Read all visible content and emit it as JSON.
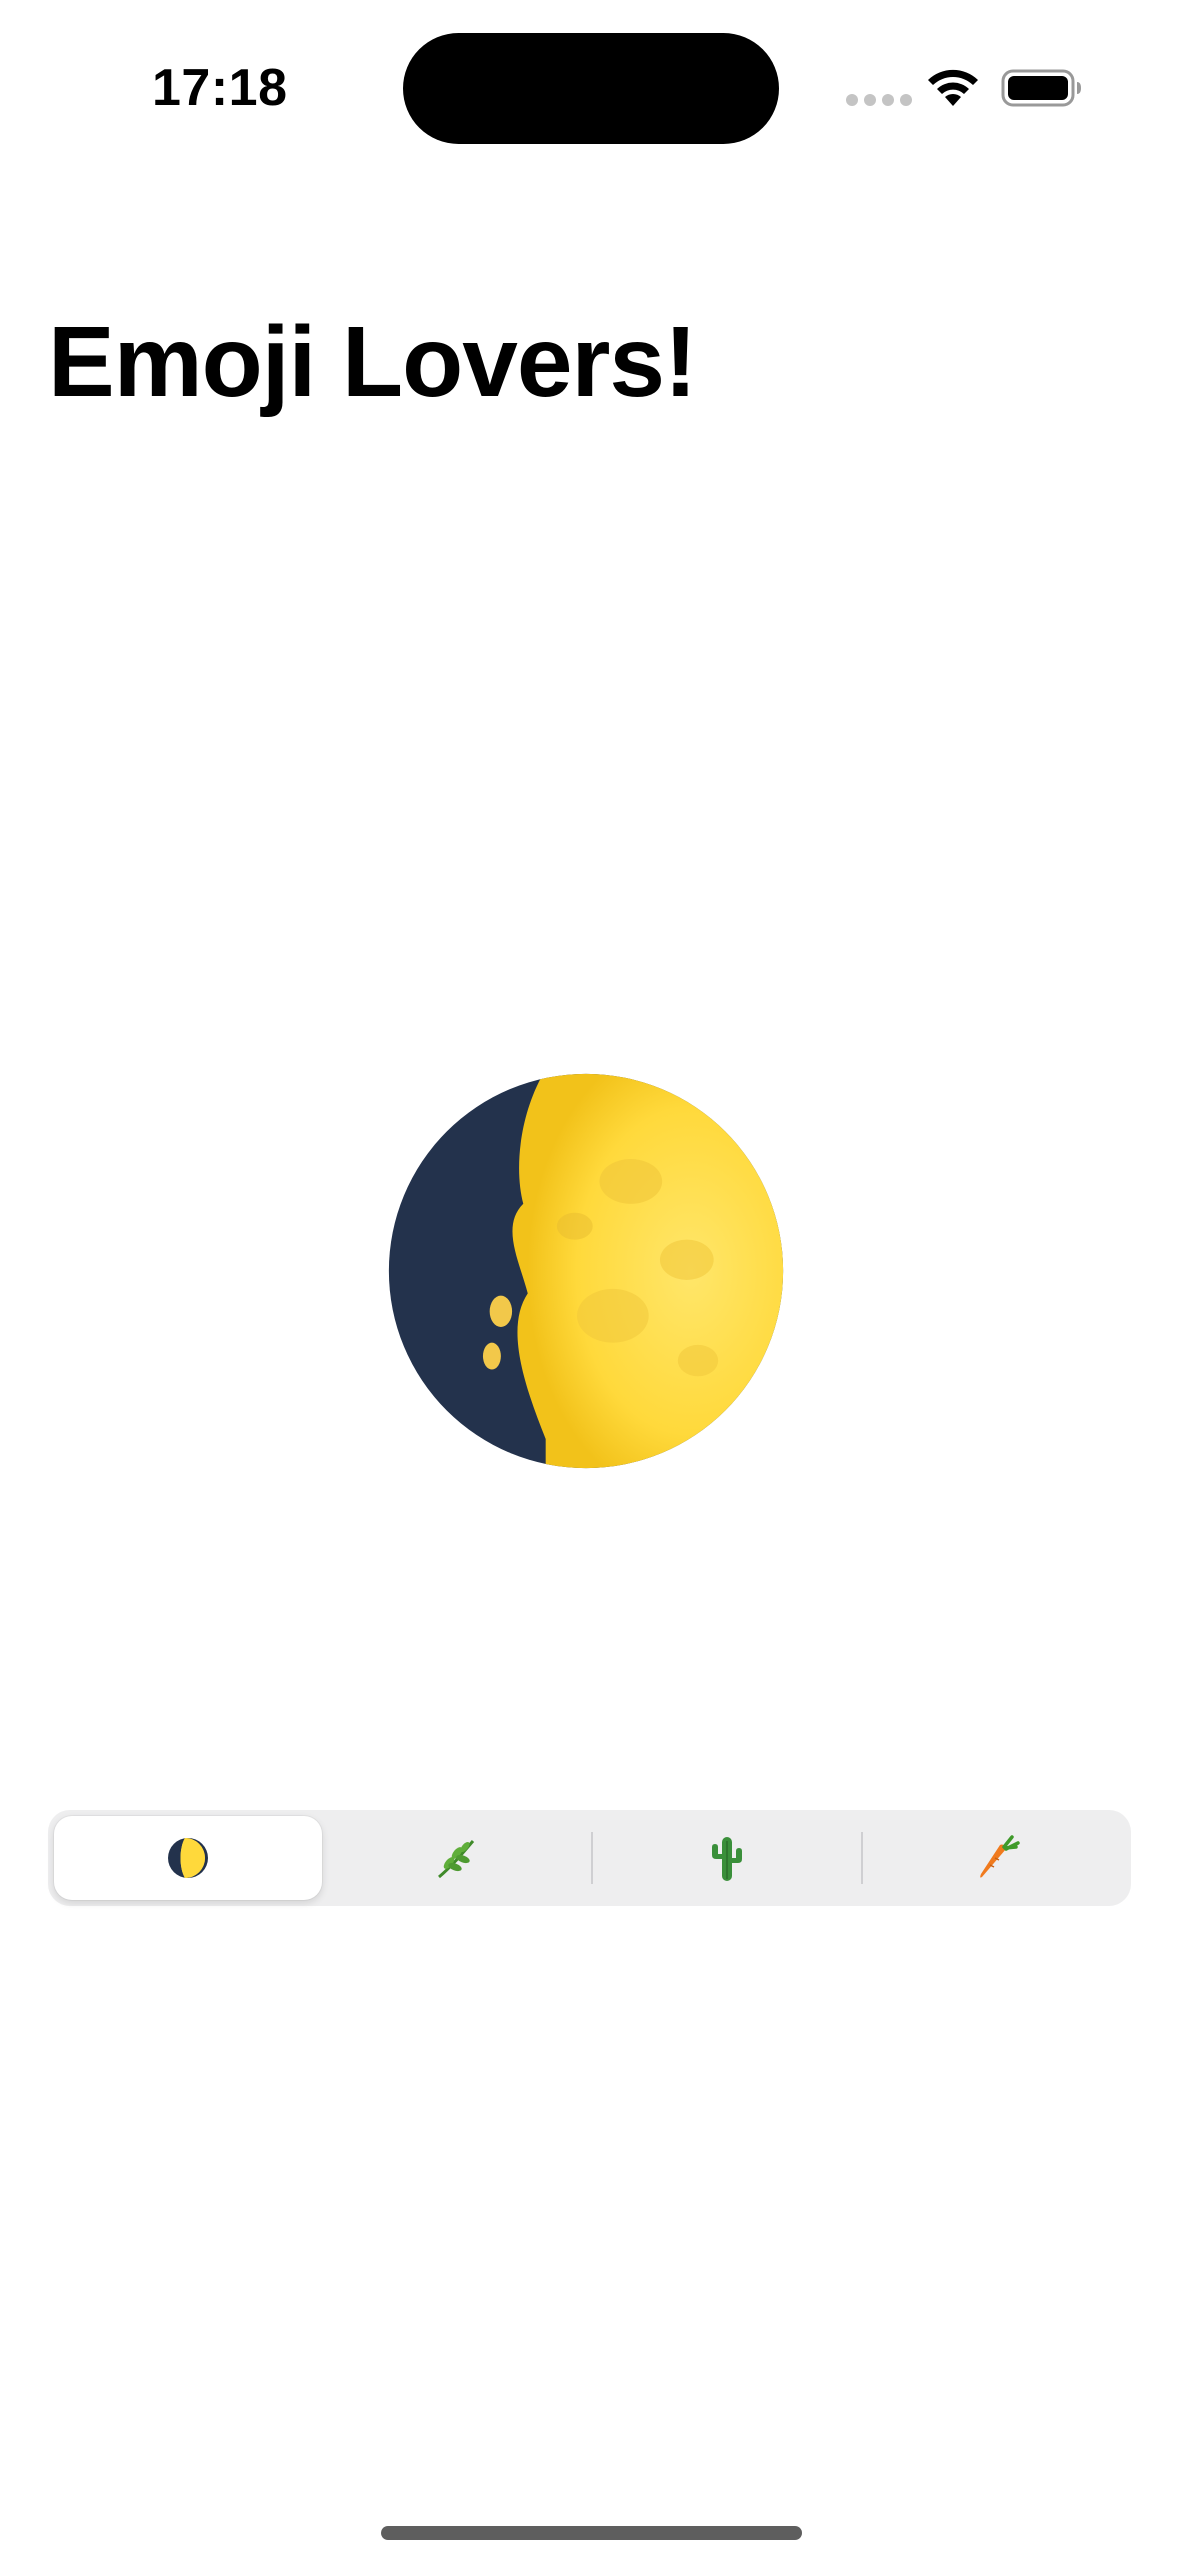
{
  "status_bar": {
    "time": "17:18",
    "icons": [
      "signal-dots-icon",
      "wifi-icon",
      "battery-icon"
    ]
  },
  "title": "Emoji Lovers!",
  "selected_emoji": {
    "icon": "first-quarter-moon-icon",
    "glyph": "🌓"
  },
  "segmented_control": {
    "selected_index": 0,
    "segments": [
      {
        "glyph": "🌓",
        "icon": "first-quarter-moon-icon"
      },
      {
        "glyph": "🌿",
        "icon": "herb-icon"
      },
      {
        "glyph": "🌵",
        "icon": "cactus-icon"
      },
      {
        "glyph": "🥕",
        "icon": "carrot-icon"
      }
    ]
  },
  "colors": {
    "segmented_background": "#eeeeef",
    "selected_segment": "#ffffff",
    "moon_dark": "#23324c",
    "moon_light": "#ffd93b"
  }
}
